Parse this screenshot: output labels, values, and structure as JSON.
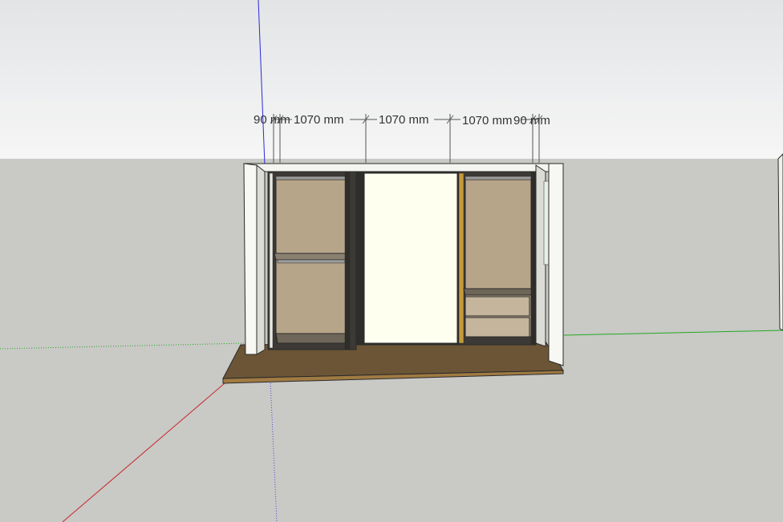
{
  "viewport": {
    "colors": {
      "sky_top": "#e4e6e8",
      "sky_horizon": "#f5f5f5",
      "ground": "#c9c9c6",
      "axis_blue": "#2a2ad8",
      "axis_red": "#c82828",
      "axis_green": "#22aa22",
      "carcass": "#f4f4f0",
      "panel_back": "#b7a58a",
      "door_face": "#fffff0",
      "floor_board": "#6b5536",
      "floor_edge": "#a07a42",
      "edge_line": "#2a2a2a"
    }
  },
  "dimensions": [
    {
      "label": "90 mm"
    },
    {
      "label": "1070 mm"
    },
    {
      "label": "1070 mm"
    },
    {
      "label": "1070 mm"
    },
    {
      "label": "90 mm"
    }
  ]
}
